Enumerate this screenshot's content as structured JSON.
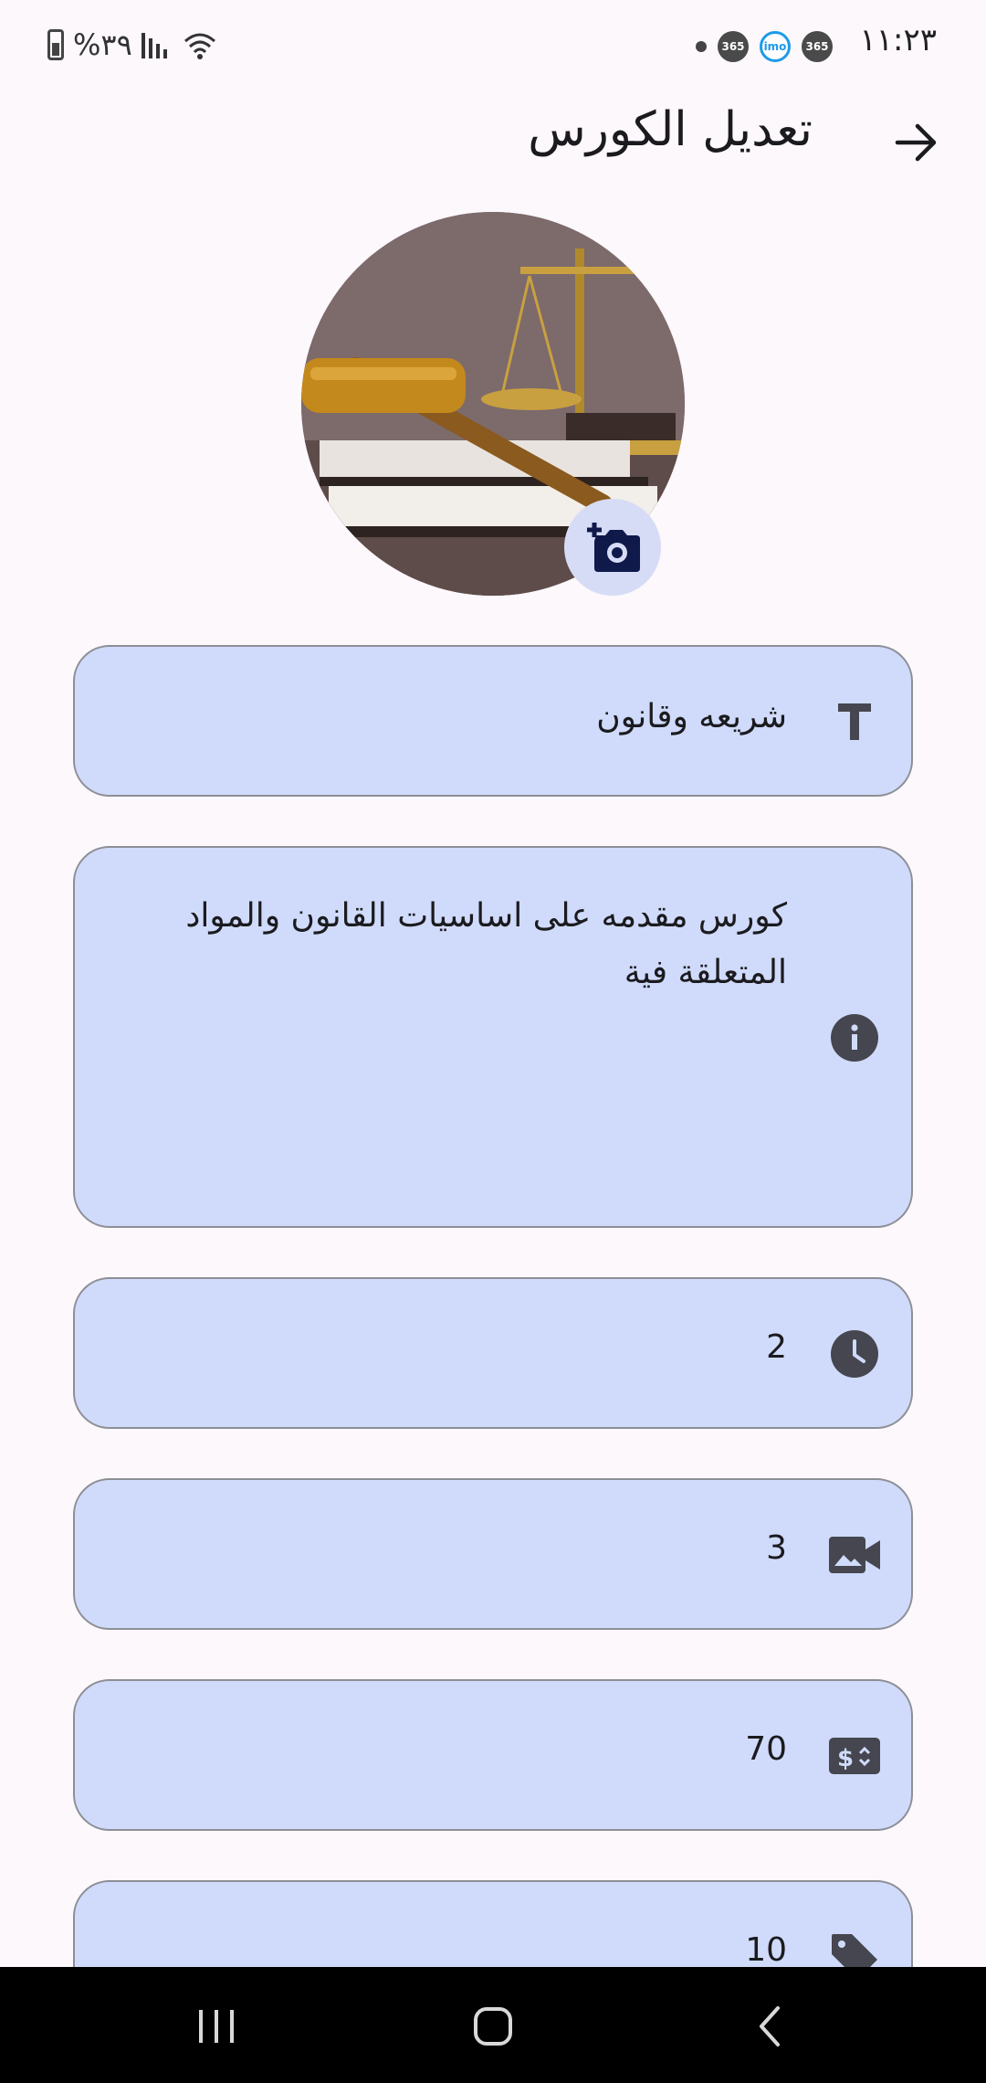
{
  "status_bar": {
    "time": "١١:٢٣",
    "battery": "%٣٩",
    "badges": [
      "365",
      "imo",
      "365"
    ]
  },
  "header": {
    "title": "تعديل الكورس",
    "back_icon": "arrow-forward-icon"
  },
  "avatar": {
    "camera_icon": "add-photo-icon"
  },
  "fields": {
    "name": {
      "icon": "title-icon",
      "value": "شريعه وقانون"
    },
    "description": {
      "icon": "info-icon",
      "value": "كورس مقدمه على اساسيات القانون والمواد المتعلقة فية"
    },
    "hours": {
      "icon": "clock-icon",
      "value": "2"
    },
    "videos": {
      "icon": "video-icon",
      "value": "3"
    },
    "price": {
      "icon": "price-icon",
      "value": "70"
    },
    "discount": {
      "icon": "tag-icon",
      "value": "10"
    }
  },
  "navigation": {
    "recents_icon": "recents-icon",
    "home_icon": "home-icon",
    "back_icon": "back-icon"
  },
  "colors": {
    "background": "#fcf8fc",
    "field_fill": "#d0dbfb",
    "field_border": "#8d8f96",
    "icon": "#45464f",
    "camera_button": "#d7dcf6"
  }
}
